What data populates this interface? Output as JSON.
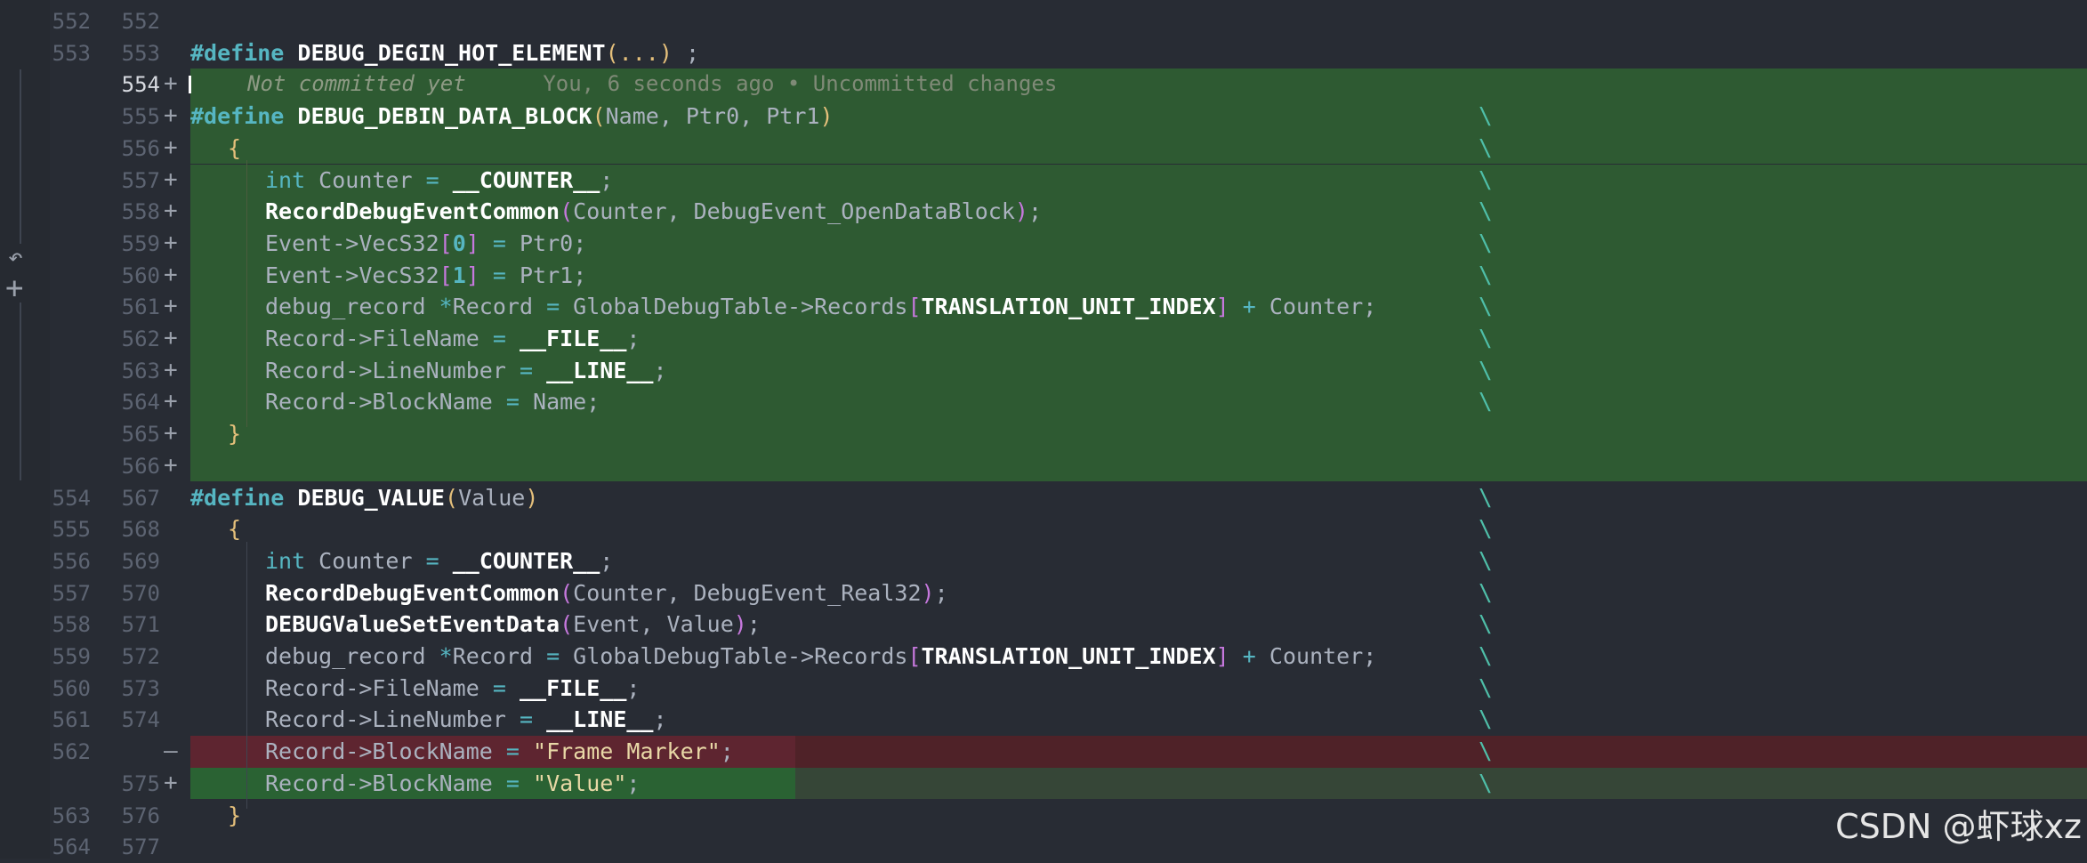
{
  "editor": {
    "blame": {
      "author": "Not committed yet",
      "detail": "You, 6 seconds ago • Uncommitted changes"
    },
    "watermark": "CSDN @虾球xz",
    "side_icons": {
      "undo": "↶",
      "add": "+"
    },
    "colors": {
      "added_bg": "#2e5a32",
      "removed_bg": "#4f2228",
      "inserted_bg": "#364637",
      "editor_bg": "#282c34"
    },
    "lines": [
      {
        "old": "552",
        "new": "552",
        "sign": "",
        "type": "normal"
      },
      {
        "old": "553",
        "new": "553",
        "sign": "",
        "type": "normal",
        "t": [
          "#define",
          "DEBUG_DEGIN_HOT_ELEMENT",
          "(",
          "...",
          ")",
          " ;"
        ]
      },
      {
        "old": "",
        "new": "554",
        "sign": "+",
        "type": "added",
        "active": true
      },
      {
        "old": "",
        "new": "555",
        "sign": "+",
        "type": "added",
        "t": [
          "#define",
          "DEBUG_DEBIN_DATA_BLOCK",
          "(",
          "Name, Ptr0, Ptr1",
          ")",
          "\\"
        ]
      },
      {
        "old": "",
        "new": "556",
        "sign": "+",
        "type": "added",
        "t": [
          "{",
          "\\"
        ]
      },
      {
        "old": "",
        "new": "557",
        "sign": "+",
        "type": "added",
        "t": [
          "int",
          " Counter ",
          "=",
          " ",
          "__COUNTER__",
          ";",
          "\\"
        ]
      },
      {
        "old": "",
        "new": "558",
        "sign": "+",
        "type": "added",
        "t": [
          "RecordDebugEventCommon",
          "(",
          "Counter, DebugEvent_OpenDataBlock",
          ")",
          ";",
          "\\"
        ]
      },
      {
        "old": "",
        "new": "559",
        "sign": "+",
        "type": "added",
        "t": [
          "Event->VecS32",
          "[",
          "0",
          "]",
          " ",
          "=",
          " Ptr0;",
          "\\"
        ]
      },
      {
        "old": "",
        "new": "560",
        "sign": "+",
        "type": "added",
        "t": [
          "Event->VecS32",
          "[",
          "1",
          "]",
          " ",
          "=",
          " Ptr1;",
          "\\"
        ]
      },
      {
        "old": "",
        "new": "561",
        "sign": "+",
        "type": "added",
        "t": [
          "debug_record ",
          "*",
          "Record ",
          "=",
          " GlobalDebugTable->Records",
          "[",
          "TRANSLATION_UNIT_INDEX",
          "]",
          " ",
          "+",
          " Counter;",
          "\\"
        ]
      },
      {
        "old": "",
        "new": "562",
        "sign": "+",
        "type": "added",
        "t": [
          "Record->FileName ",
          "=",
          " ",
          "__FILE__",
          ";",
          "\\"
        ]
      },
      {
        "old": "",
        "new": "563",
        "sign": "+",
        "type": "added",
        "t": [
          "Record->LineNumber ",
          "=",
          " ",
          "__LINE__",
          ";",
          "\\"
        ]
      },
      {
        "old": "",
        "new": "564",
        "sign": "+",
        "type": "added",
        "t": [
          "Record->BlockName ",
          "=",
          " Name;",
          "\\"
        ]
      },
      {
        "old": "",
        "new": "565",
        "sign": "+",
        "type": "added",
        "t": [
          "}"
        ]
      },
      {
        "old": "",
        "new": "566",
        "sign": "+",
        "type": "added"
      },
      {
        "old": "554",
        "new": "567",
        "sign": "",
        "type": "normal",
        "t": [
          "#define",
          "DEBUG_VALUE",
          "(",
          "Value",
          ")",
          "\\"
        ]
      },
      {
        "old": "555",
        "new": "568",
        "sign": "",
        "type": "normal",
        "t": [
          "{",
          "\\"
        ]
      },
      {
        "old": "556",
        "new": "569",
        "sign": "",
        "type": "normal",
        "t": [
          "int",
          " Counter ",
          "=",
          " ",
          "__COUNTER__",
          ";",
          "\\"
        ]
      },
      {
        "old": "557",
        "new": "570",
        "sign": "",
        "type": "normal",
        "t": [
          "RecordDebugEventCommon",
          "(",
          "Counter, DebugEvent_Real32",
          ")",
          ";",
          "\\"
        ]
      },
      {
        "old": "558",
        "new": "571",
        "sign": "",
        "type": "normal",
        "t": [
          "DEBUGValueSetEventData",
          "(",
          "Event, Value",
          ")",
          ";",
          "\\"
        ]
      },
      {
        "old": "559",
        "new": "572",
        "sign": "",
        "type": "normal",
        "t": [
          "debug_record ",
          "*",
          "Record ",
          "=",
          " GlobalDebugTable->Records",
          "[",
          "TRANSLATION_UNIT_INDEX",
          "]",
          " ",
          "+",
          " Counter;",
          "\\"
        ]
      },
      {
        "old": "560",
        "new": "573",
        "sign": "",
        "type": "normal",
        "t": [
          "Record->FileName ",
          "=",
          " ",
          "__FILE__",
          ";",
          "\\"
        ]
      },
      {
        "old": "561",
        "new": "574",
        "sign": "",
        "type": "normal",
        "t": [
          "Record->LineNumber ",
          "=",
          " ",
          "__LINE__",
          ";",
          "\\"
        ]
      },
      {
        "old": "562",
        "new": "",
        "sign": "—",
        "type": "removed",
        "t": [
          "Record->BlockName ",
          "=",
          " ",
          "\"Frame Marker\"",
          ";",
          "\\"
        ]
      },
      {
        "old": "",
        "new": "575",
        "sign": "+",
        "type": "inserted",
        "t": [
          "Record->BlockName ",
          "=",
          " ",
          "\"Value\"",
          ";",
          "\\"
        ]
      },
      {
        "old": "563",
        "new": "576",
        "sign": "",
        "type": "normal",
        "t": [
          "}"
        ]
      },
      {
        "old": "564",
        "new": "577",
        "sign": "",
        "type": "normal"
      }
    ]
  }
}
